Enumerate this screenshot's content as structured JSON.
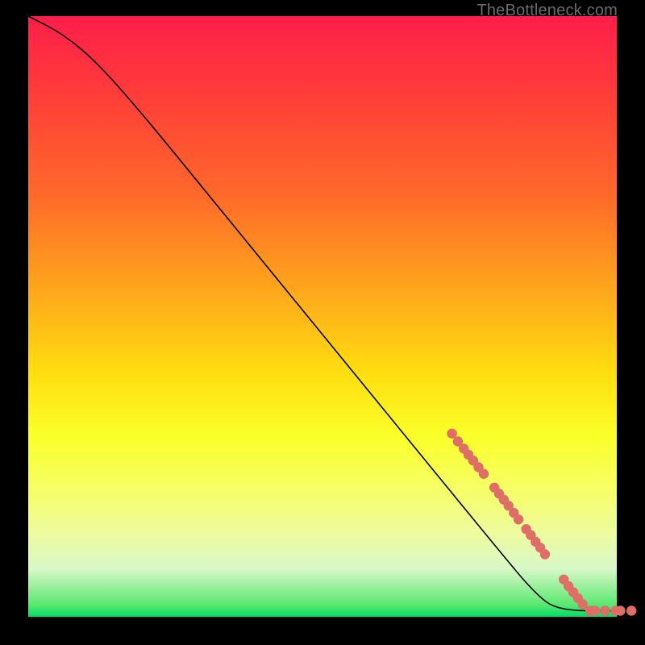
{
  "watermark": "TheBottleneck.com",
  "chart_data": {
    "type": "line",
    "title": "",
    "xlabel": "",
    "ylabel": "",
    "xlim": [
      0,
      100
    ],
    "ylim": [
      0,
      100
    ],
    "grid": false,
    "legend": false,
    "curve": [
      {
        "x": 0,
        "y": 100
      },
      {
        "x": 6,
        "y": 97
      },
      {
        "x": 12,
        "y": 92
      },
      {
        "x": 20,
        "y": 83
      },
      {
        "x": 30,
        "y": 71
      },
      {
        "x": 40,
        "y": 59
      },
      {
        "x": 50,
        "y": 47
      },
      {
        "x": 60,
        "y": 35
      },
      {
        "x": 70,
        "y": 23
      },
      {
        "x": 80,
        "y": 11
      },
      {
        "x": 86,
        "y": 4
      },
      {
        "x": 90,
        "y": 1
      },
      {
        "x": 100,
        "y": 1
      }
    ],
    "markers": [
      {
        "x": 72.0,
        "y": 30.5
      },
      {
        "x": 73.0,
        "y": 29.2
      },
      {
        "x": 74.0,
        "y": 28.0
      },
      {
        "x": 74.8,
        "y": 27.0
      },
      {
        "x": 75.6,
        "y": 26.0
      },
      {
        "x": 76.5,
        "y": 24.9
      },
      {
        "x": 77.4,
        "y": 23.8
      },
      {
        "x": 79.2,
        "y": 21.5
      },
      {
        "x": 80.0,
        "y": 20.5
      },
      {
        "x": 80.8,
        "y": 19.5
      },
      {
        "x": 81.6,
        "y": 18.5
      },
      {
        "x": 82.5,
        "y": 17.3
      },
      {
        "x": 83.3,
        "y": 16.2
      },
      {
        "x": 84.6,
        "y": 14.6
      },
      {
        "x": 85.4,
        "y": 13.6
      },
      {
        "x": 86.2,
        "y": 12.5
      },
      {
        "x": 87.0,
        "y": 11.5
      },
      {
        "x": 87.8,
        "y": 10.4
      },
      {
        "x": 91.0,
        "y": 6.2
      },
      {
        "x": 91.8,
        "y": 5.1
      },
      {
        "x": 92.6,
        "y": 4.1
      },
      {
        "x": 93.4,
        "y": 3.1
      },
      {
        "x": 94.2,
        "y": 2.1
      },
      {
        "x": 95.5,
        "y": 1.0
      },
      {
        "x": 96.3,
        "y": 1.0
      },
      {
        "x": 98.0,
        "y": 1.0
      },
      {
        "x": 99.8,
        "y": 1.0
      },
      {
        "x": 100.6,
        "y": 1.0
      },
      {
        "x": 102.5,
        "y": 1.0
      }
    ]
  }
}
